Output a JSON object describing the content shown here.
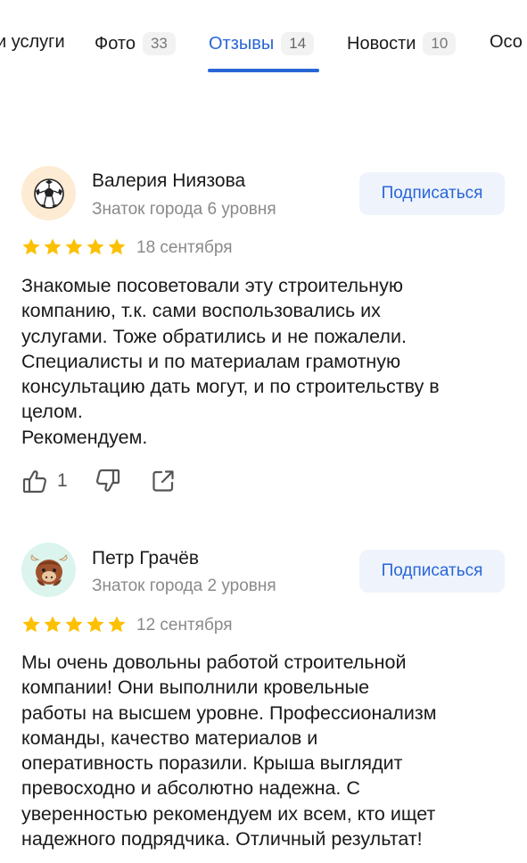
{
  "tabs": [
    {
      "label": "Цены и услуги",
      "visible": "и услуги",
      "count": ""
    },
    {
      "label": "Фото",
      "count": "33"
    },
    {
      "label": "Отзывы",
      "count": "14",
      "active": true
    },
    {
      "label": "Новости",
      "count": "10"
    },
    {
      "label": "Особенности",
      "visible": "Осо",
      "count": ""
    }
  ],
  "reviews": [
    {
      "author": "Валерия Ниязова",
      "level": "Знаток города 6 уровня",
      "avatar_icon": "soccer-ball-icon",
      "subscribe_label": "Подписаться",
      "rating": 5,
      "date": "18 сентября",
      "text": "Знакомые посоветовали эту строительную\nкомпанию, т.к. сами воспользовались их\nуслугами. Тоже обратились и не пожалели.\nСпециалисты и по материалам грамотную\nконсультацию дать могут, и по строительству в\nцелом.\nРекомендуем.",
      "likes": "1"
    },
    {
      "author": "Петр Грачёв",
      "level": "Знаток города 2 уровня",
      "avatar_icon": "yak-icon",
      "subscribe_label": "Подписаться",
      "rating": 5,
      "date": "12 сентября",
      "text": "Мы очень довольны работой строительной\nкомпании! Они выполнили кровельные\nработы на высшем уровне. Профессионализм\nкоманды, качество материалов и\nоперативность поразили. Крыша выглядит\nпревосходно и абсолютно надежна. С\nуверенностью рекомендуем их всем, кто ищет\nнадежного подрядчика. Отличный результат!"
    }
  ],
  "colors": {
    "accent": "#2a66d6",
    "star": "#fcc000",
    "muted": "#8a8a8a",
    "subscribe_bg": "#eef3fc"
  }
}
